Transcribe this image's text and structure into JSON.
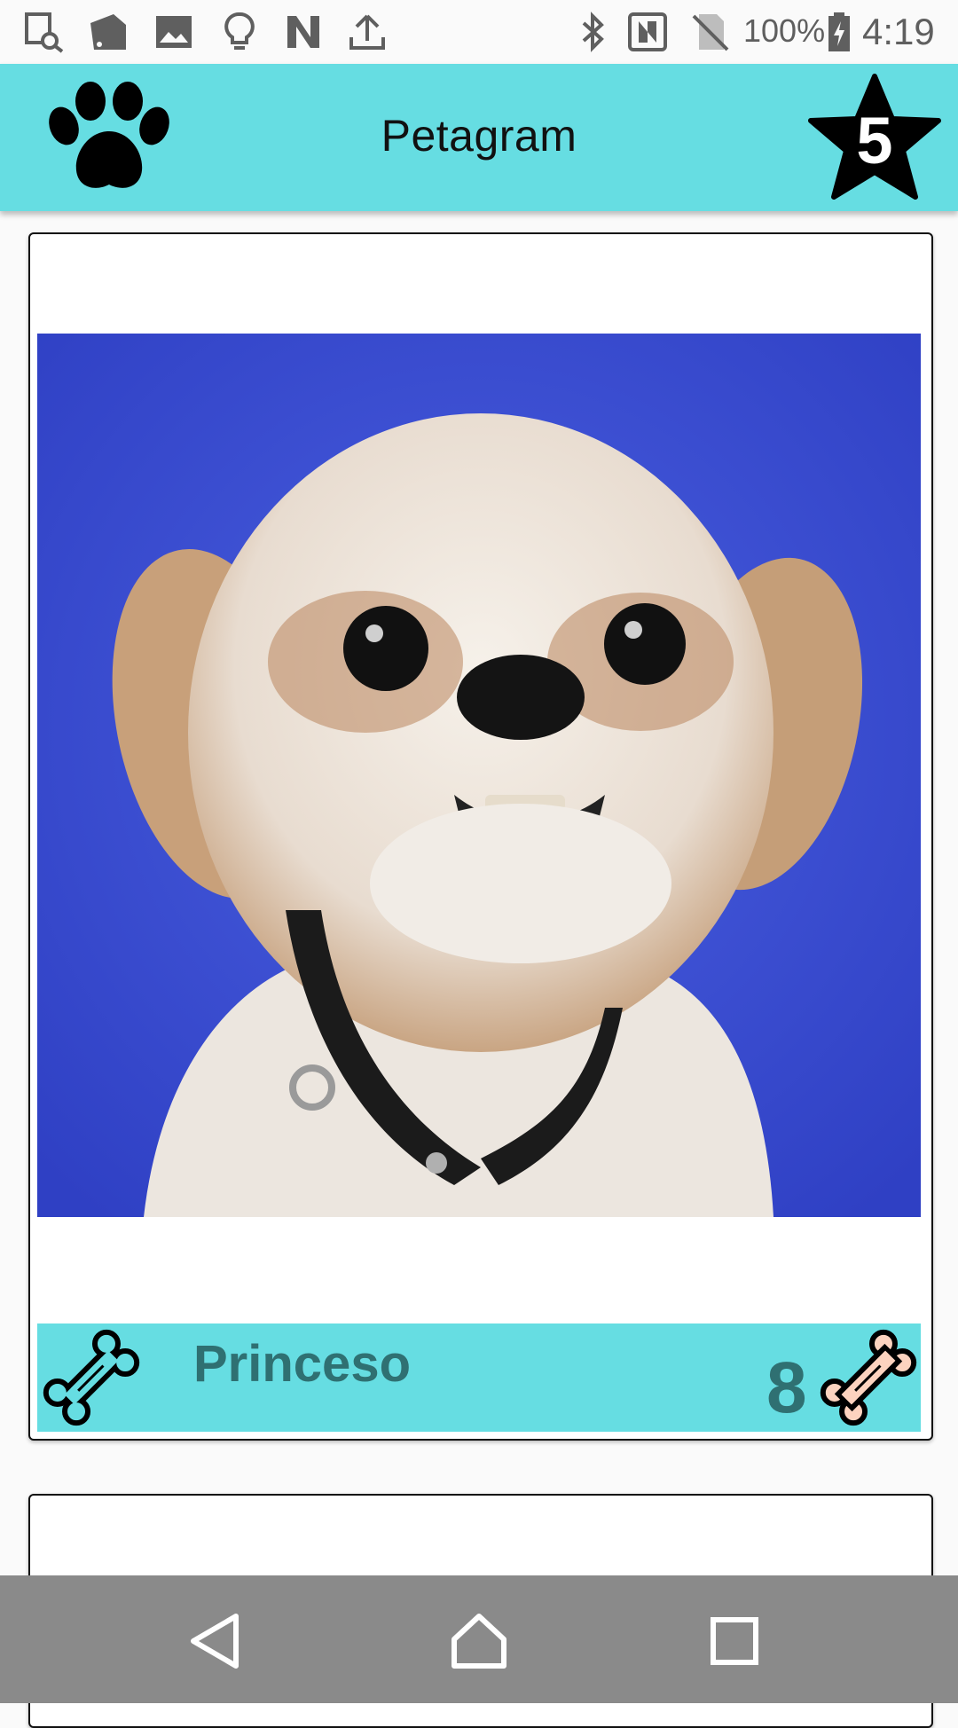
{
  "status_bar": {
    "battery": "100%",
    "time": "4:19",
    "left_icons": [
      "image-search-icon",
      "swatches-icon",
      "image-icon",
      "bulb-icon",
      "n-logo-icon",
      "upload-icon"
    ],
    "right_icons": [
      "bluetooth-icon",
      "nfc-icon",
      "no-sim-icon",
      "battery-icon"
    ]
  },
  "app_bar": {
    "title": "Petagram",
    "logo_icon": "paw-icon",
    "favorites_icon": "star-icon",
    "favorites_count": "5",
    "color": "#66dde2"
  },
  "cards": [
    {
      "photo_icon": "dog-photo",
      "name": "Princeso",
      "likes": "8",
      "like_button_icon": "bone-icon",
      "likes_icon": "bone-filled-icon"
    }
  ],
  "nav_bar": {
    "back_icon": "back-triangle-icon",
    "home_icon": "home-icon",
    "recents_icon": "recents-square-icon"
  }
}
